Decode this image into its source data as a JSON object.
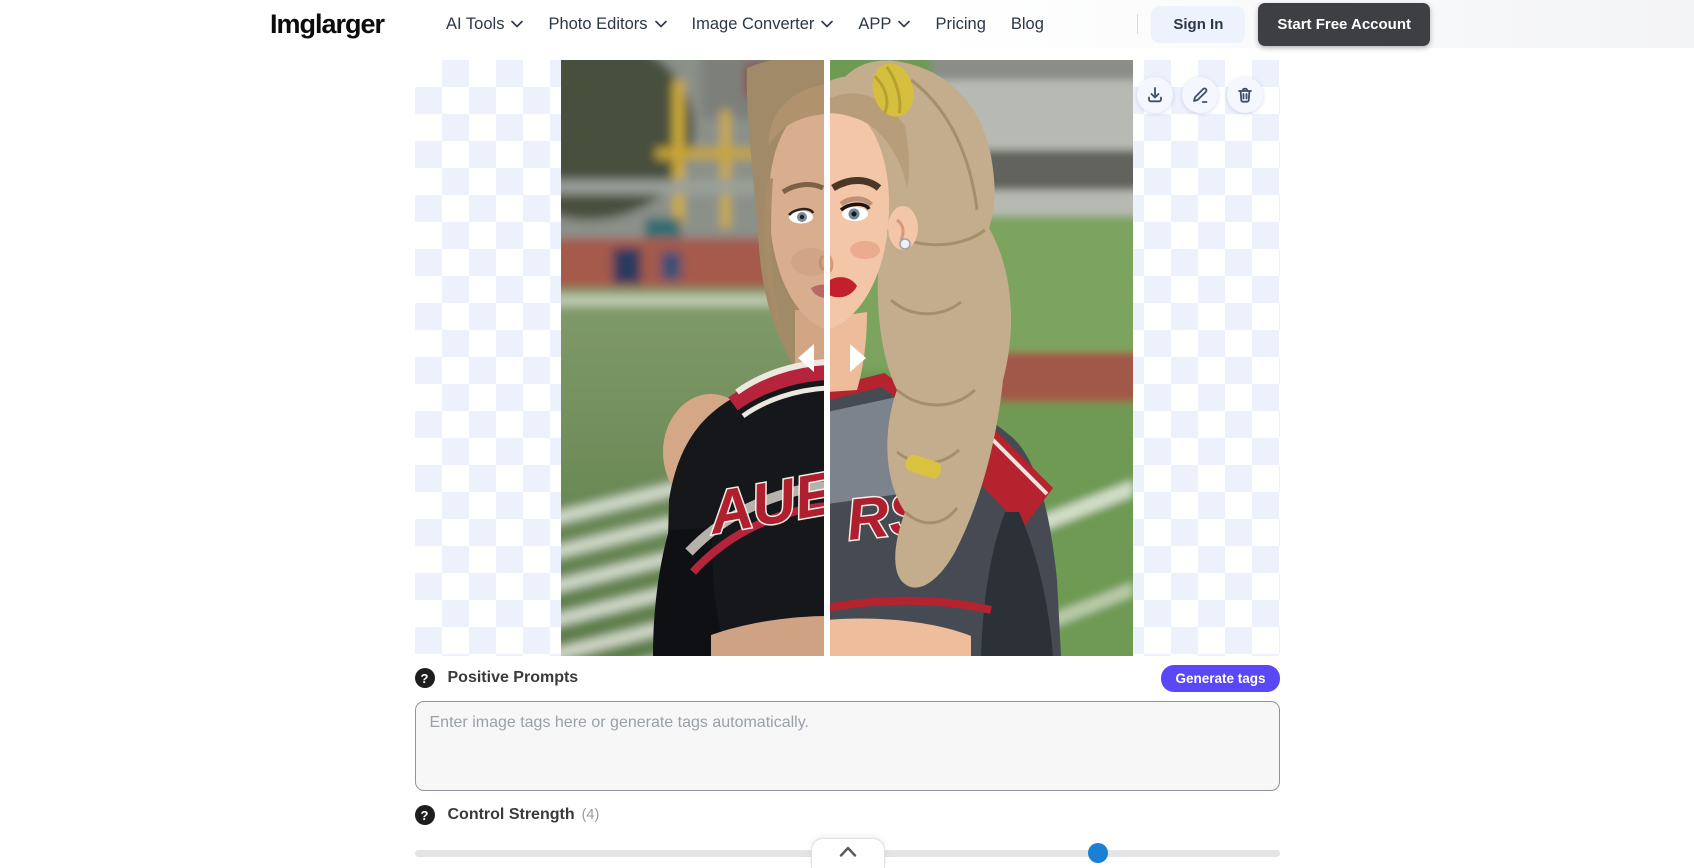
{
  "header": {
    "logo": "Imglarger",
    "nav_items": [
      {
        "label": "AI Tools",
        "dropdown": true
      },
      {
        "label": "Photo Editors",
        "dropdown": true
      },
      {
        "label": "Image Converter",
        "dropdown": true
      },
      {
        "label": "APP",
        "dropdown": true
      },
      {
        "label": "Pricing",
        "dropdown": false
      },
      {
        "label": "Blog",
        "dropdown": false
      }
    ],
    "sign_in_label": "Sign In",
    "start_free_label": "Start Free Account"
  },
  "viewer": {
    "jersey_text_left": "AUE",
    "jersey_text_right": "RS",
    "action_icons": [
      "download-icon",
      "edit-icon",
      "delete-icon"
    ]
  },
  "positive_prompts": {
    "label": "Positive Prompts",
    "generate_button_label": "Generate tags",
    "textarea_value": "",
    "textarea_placeholder": "Enter image tags here or generate tags automatically."
  },
  "control_strength": {
    "label": "Control Strength",
    "value_label": "(4)",
    "value": 4,
    "slider_percent": 79
  },
  "icons": {
    "help_glyph": "?"
  },
  "colors": {
    "accent_purple": "#5a47f5",
    "slider_blue": "#1b7fd4",
    "dark_button": "#3d3f42",
    "checker_tint": "#edf1fc",
    "nav_text": "#2c3748"
  }
}
